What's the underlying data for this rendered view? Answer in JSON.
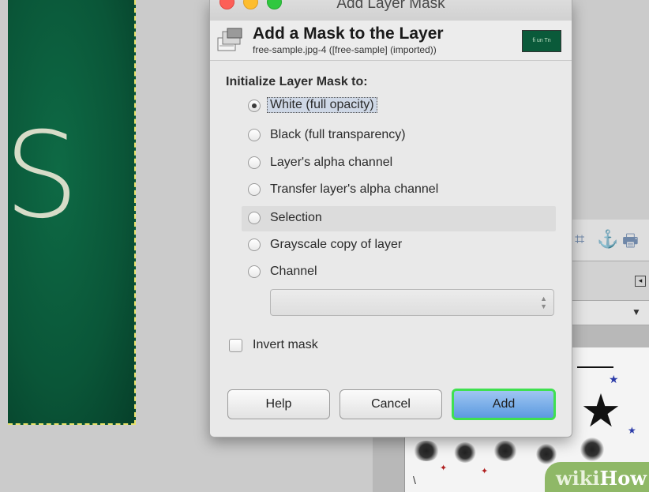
{
  "window": {
    "title": "Add Layer Mask",
    "header_title": "Add a Mask to the Layer",
    "header_subtitle": "free-sample.jpg-4 ([free-sample] (imported))",
    "thumbnail_text": "fi un Tn"
  },
  "background": {
    "canvas_letter": "S",
    "watermark_part1": "wiki",
    "watermark_part2": "How"
  },
  "form": {
    "section_label": "Initialize Layer Mask to:",
    "options": [
      {
        "label": "White (full opacity)",
        "checked": true
      },
      {
        "label": "Black (full transparency)",
        "checked": false
      },
      {
        "label": "Layer's alpha channel",
        "checked": false
      },
      {
        "label": "Transfer layer's alpha channel",
        "checked": false
      },
      {
        "label": "Selection",
        "checked": false
      },
      {
        "label": "Grayscale copy of layer",
        "checked": false
      },
      {
        "label": "Channel",
        "checked": false
      }
    ],
    "channel_select_value": "",
    "invert_label": "Invert mask",
    "invert_checked": false
  },
  "buttons": {
    "help": "Help",
    "cancel": "Cancel",
    "add": "Add"
  },
  "colors": {
    "add_button_outline": "#3fe050",
    "add_button_fill": "#5c9ae0",
    "image_green": "#0a5638",
    "selection_dash": "#e8e26a"
  }
}
